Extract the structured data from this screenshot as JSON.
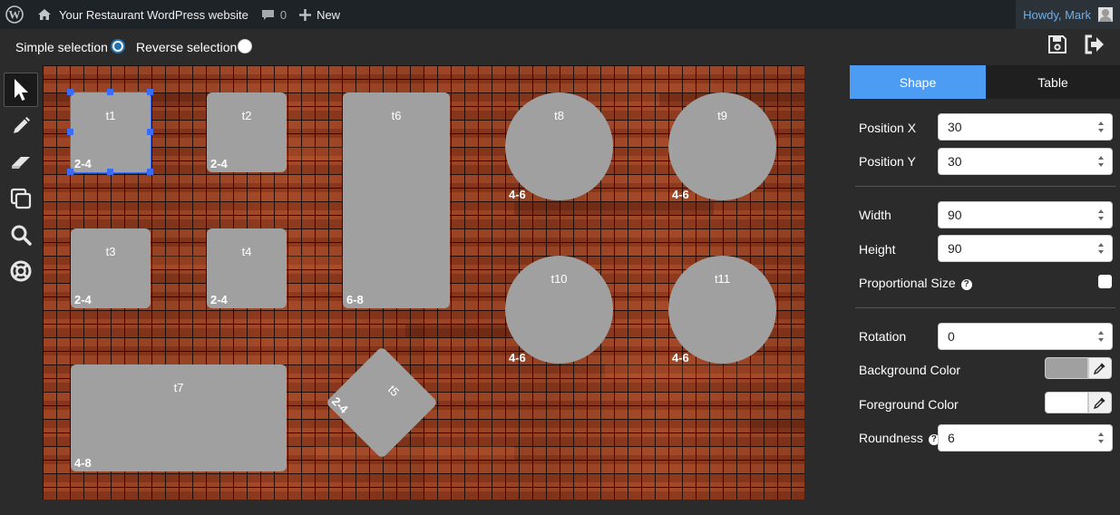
{
  "admin_bar": {
    "site_name": "Your Restaurant WordPress website",
    "comments_count": "0",
    "new_label": "New",
    "howdy": "Howdy, Mark"
  },
  "selection": {
    "simple_label": "Simple selection",
    "reverse_label": "Reverse selection",
    "selected_mode": "simple"
  },
  "tools": [
    "pointer-icon",
    "pencil-icon",
    "eraser-icon",
    "copy-icon",
    "magnifier-icon",
    "lifebuoy-icon"
  ],
  "tables": [
    {
      "name": "t1",
      "capacity": "2-4",
      "shape": "square",
      "selected": true
    },
    {
      "name": "t2",
      "capacity": "2-4",
      "shape": "square"
    },
    {
      "name": "t3",
      "capacity": "2-4",
      "shape": "square"
    },
    {
      "name": "t4",
      "capacity": "2-4",
      "shape": "square"
    },
    {
      "name": "t5",
      "capacity": "2-4",
      "shape": "square",
      "rotation_deg": 45
    },
    {
      "name": "t6",
      "capacity": "6-8",
      "shape": "rectangle"
    },
    {
      "name": "t7",
      "capacity": "4-8",
      "shape": "rectangle"
    },
    {
      "name": "t8",
      "capacity": "4-6",
      "shape": "circle"
    },
    {
      "name": "t9",
      "capacity": "4-6",
      "shape": "circle"
    },
    {
      "name": "t10",
      "capacity": "4-6",
      "shape": "circle"
    },
    {
      "name": "t11",
      "capacity": "4-6",
      "shape": "circle"
    }
  ],
  "panel": {
    "tabs": [
      "Shape",
      "Table"
    ],
    "active_tab": "Shape",
    "position_x_label": "Position X",
    "position_x": "30",
    "position_y_label": "Position Y",
    "position_y": "30",
    "width_label": "Width",
    "width": "90",
    "height_label": "Height",
    "height": "90",
    "proportional_label": "Proportional Size",
    "proportional_checked": false,
    "rotation_label": "Rotation",
    "rotation": "0",
    "bg_color_label": "Background Color",
    "bg_color": "#a0a0a0",
    "fg_color_label": "Foreground Color",
    "fg_color": "#ffffff",
    "roundness_label": "Roundness",
    "roundness": "6"
  },
  "colors": {
    "accent": "#4c9cf4",
    "selection": "#3b6cf5",
    "table_fill": "#a0a0a0",
    "floor": "#8c3b1e"
  }
}
